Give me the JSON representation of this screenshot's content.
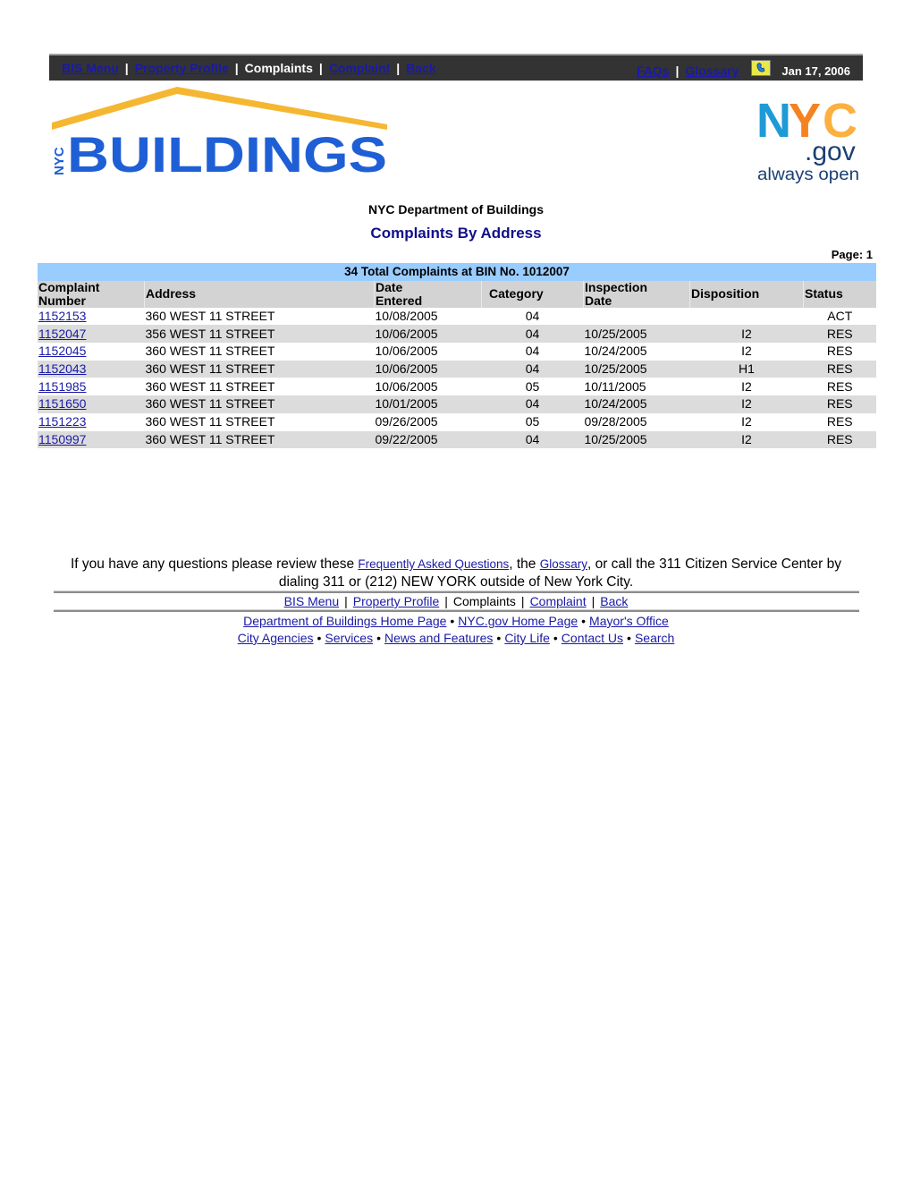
{
  "topnav": {
    "items": [
      {
        "label": "BIS Menu",
        "link": true
      },
      {
        "label": "Property Profile",
        "link": true
      },
      {
        "label": "Complaints",
        "link": false
      },
      {
        "label": "Complaint",
        "link": true
      },
      {
        "label": "Back",
        "link": true
      }
    ],
    "faqs_label": "FAQs",
    "glossary_label": "Glossary",
    "separator": "|",
    "date": "Jan 17, 2006",
    "help_icon": "help-hand-icon"
  },
  "logos": {
    "buildings": {
      "prefix": "NYC",
      "word": "BUILDINGS",
      "roof_color": "#f5b731",
      "text_color": "#1f5fd6"
    },
    "nycgov": {
      "n": "N",
      "y": "Y",
      "c": "C",
      "gov": ".gov",
      "tagline": "always open",
      "blue": "#1e9ad6",
      "orange": "#f58220",
      "navy": "#1b3f73"
    }
  },
  "header": {
    "department": "NYC Department of Buildings",
    "title": "Complaints By Address",
    "page_label": "Page: 1"
  },
  "table": {
    "caption": "34 Total Complaints at BIN No. 1012007",
    "columns": [
      {
        "line1": "Complaint",
        "line2": "Number"
      },
      {
        "line1": "Address",
        "line2": ""
      },
      {
        "line1": "Date",
        "line2": "Entered"
      },
      {
        "line1": "Category",
        "line2": ""
      },
      {
        "line1": "Inspection",
        "line2": "Date"
      },
      {
        "line1": "Disposition",
        "line2": ""
      },
      {
        "line1": "Status",
        "line2": ""
      }
    ],
    "rows": [
      {
        "number": "1152153",
        "address": "360 WEST 11 STREET",
        "date_entered": "10/08/2005",
        "category": "04",
        "inspection_date": "",
        "disposition": "",
        "status": "ACT"
      },
      {
        "number": "1152047",
        "address": "356 WEST 11 STREET",
        "date_entered": "10/06/2005",
        "category": "04",
        "inspection_date": "10/25/2005",
        "disposition": "I2",
        "status": "RES"
      },
      {
        "number": "1152045",
        "address": "360 WEST 11 STREET",
        "date_entered": "10/06/2005",
        "category": "04",
        "inspection_date": "10/24/2005",
        "disposition": "I2",
        "status": "RES"
      },
      {
        "number": "1152043",
        "address": "360 WEST 11 STREET",
        "date_entered": "10/06/2005",
        "category": "04",
        "inspection_date": "10/25/2005",
        "disposition": "H1",
        "status": "RES"
      },
      {
        "number": "1151985",
        "address": "360 WEST 11 STREET",
        "date_entered": "10/06/2005",
        "category": "05",
        "inspection_date": "10/11/2005",
        "disposition": "I2",
        "status": "RES"
      },
      {
        "number": "1151650",
        "address": "360 WEST 11 STREET",
        "date_entered": "10/01/2005",
        "category": "04",
        "inspection_date": "10/24/2005",
        "disposition": "I2",
        "status": "RES"
      },
      {
        "number": "1151223",
        "address": "360 WEST 11 STREET",
        "date_entered": "09/26/2005",
        "category": "05",
        "inspection_date": "09/28/2005",
        "disposition": "I2",
        "status": "RES"
      },
      {
        "number": "1150997",
        "address": "360 WEST 11 STREET",
        "date_entered": "09/22/2005",
        "category": "04",
        "inspection_date": "10/25/2005",
        "disposition": "I2",
        "status": "RES"
      }
    ]
  },
  "footer": {
    "text_before": "If you have any questions please review these ",
    "faq_link": "Frequently Asked Questions",
    "text_middle": ", the ",
    "glossary_link": "Glossary",
    "text_after": ", or call the 311 Citizen Service Center by dialing 311 or (212) NEW YORK outside of New York City.",
    "nav": [
      {
        "label": "BIS Menu",
        "link": true
      },
      {
        "label": "Property Profile",
        "link": true
      },
      {
        "label": "Complaints",
        "link": false
      },
      {
        "label": "Complaint",
        "link": true
      },
      {
        "label": "Back",
        "link": true
      }
    ],
    "links_row1": [
      "Department of Buildings Home Page",
      "NYC.gov Home Page",
      "Mayor's Office"
    ],
    "links_row2": [
      "City Agencies",
      "Services",
      "News and Features",
      "City Life",
      "Contact Us",
      "Search"
    ],
    "bullet": "•"
  }
}
